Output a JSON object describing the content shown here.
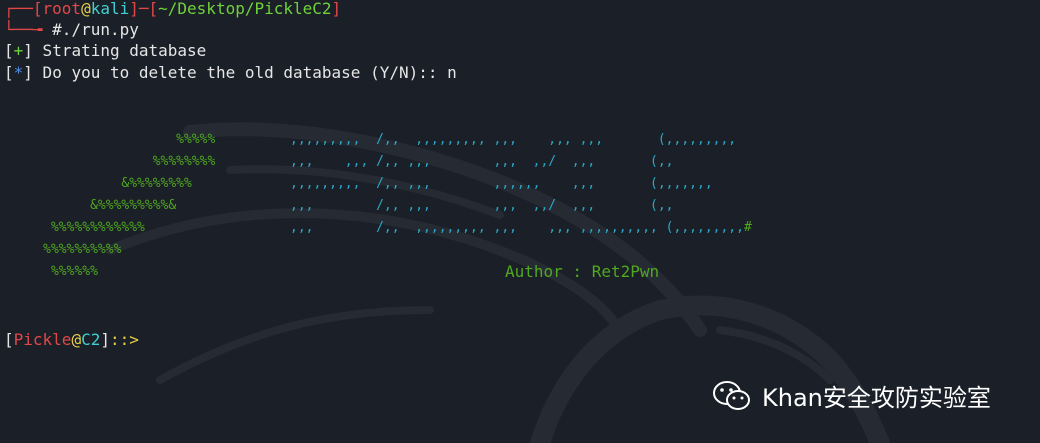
{
  "prompt": {
    "top_prefix": "┌──[",
    "user": "root",
    "at": "@",
    "host": "kali",
    "sep": "]─[",
    "path": "~/Desktop/PickleC2",
    "close": "]",
    "second_prefix": "└──╼ ",
    "command": "#./run.py"
  },
  "output": [
    {
      "open": "[",
      "mark": "+",
      "close": "]",
      "text": " Strating database"
    },
    {
      "open": "[",
      "mark": "*",
      "close": "]",
      "text": " Do you to delete the old database (Y/N):: n"
    }
  ],
  "art": {
    "percent_lines": [
      "                      %%%%%",
      "                   %%%%%%%%",
      "               &%%%%%%%%",
      "           &%%%%%%%%%&",
      "      %%%%%%%%%%%%",
      "     %%%%%%%%%%",
      "      %%%%%%"
    ],
    "comma_lines": [
      ",,,,,,,,,  /,,  ,,,,,,,,, ,,,    ,,, ,,,       (,,,,,,,,,",
      ",,,    ,,, /,, ,,,        ,,,  ,,/  ,,,       (,,",
      ",,,,,,,,,  /,, ,,,        ,,,,,,    ,,,       (,,,,,,,",
      ",,,        /,, ,,,        ,,,  ,,/  ,,,       (,,",
      ",,,        /,,  ,,,,,,,,, ,,,    ,,, ,,,,,,,,,, (,,,,,,,,,"
    ],
    "hash": "#"
  },
  "author": "Author : Ret2Pwn",
  "prompt2": {
    "open": "[",
    "user": "Pickle",
    "at": "@",
    "host": "C2",
    "close": "]",
    "arrow": "::>"
  },
  "watermark": {
    "text": "Khan安全攻防实验室",
    "icon": "wechat-icon"
  }
}
